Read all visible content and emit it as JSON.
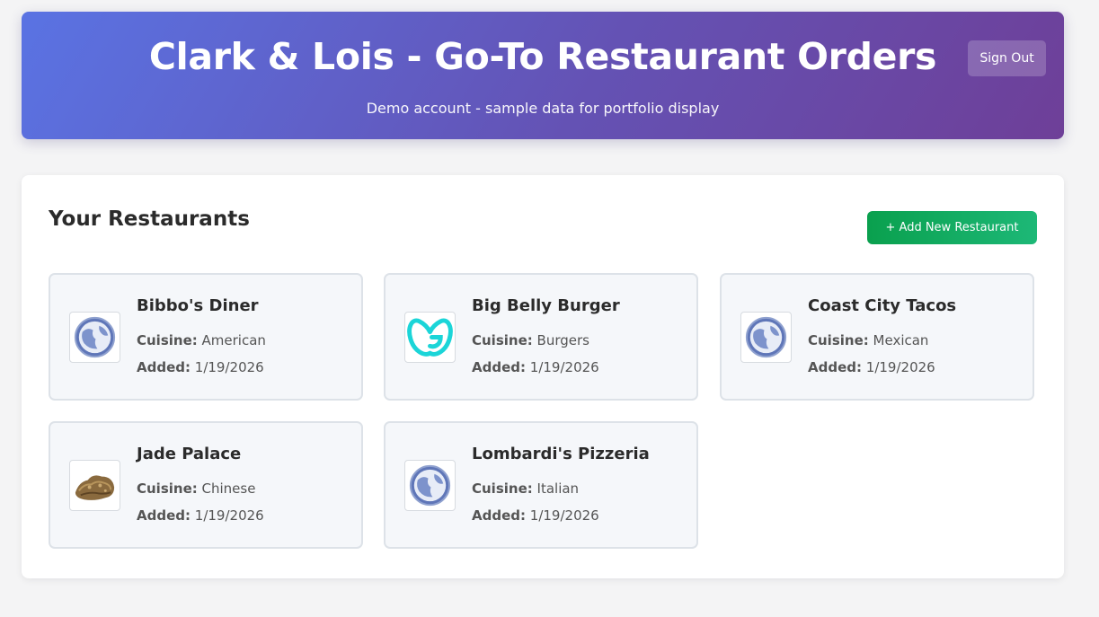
{
  "header": {
    "title": "Clark & Lois - Go-To Restaurant Orders",
    "subtitle": "Demo account - sample data for portfolio display",
    "sign_out_label": "Sign Out"
  },
  "main": {
    "section_title": "Your Restaurants",
    "add_button_label": "+ Add New Restaurant",
    "cuisine_label": "Cuisine:",
    "added_label": "Added:",
    "restaurants": [
      {
        "name": "Bibbo's Diner",
        "cuisine": "American",
        "added": "1/19/2026",
        "logo": "globe-icon"
      },
      {
        "name": "Big Belly Burger",
        "cuisine": "Burgers",
        "added": "1/19/2026",
        "logo": "godaddy-logo-icon"
      },
      {
        "name": "Coast City Tacos",
        "cuisine": "Mexican",
        "added": "1/19/2026",
        "logo": "globe-icon"
      },
      {
        "name": "Jade Palace",
        "cuisine": "Chinese",
        "added": "1/19/2026",
        "logo": "food-photo-icon"
      },
      {
        "name": "Lombardi's Pizzeria",
        "cuisine": "Italian",
        "added": "1/19/2026",
        "logo": "globe-icon"
      }
    ]
  },
  "colors": {
    "header_gradient_start": "#5a73e3",
    "header_gradient_end": "#6e3f98",
    "add_button": "#0aa04e",
    "card_background": "#f5f7fa",
    "card_border": "#dde2e8"
  }
}
